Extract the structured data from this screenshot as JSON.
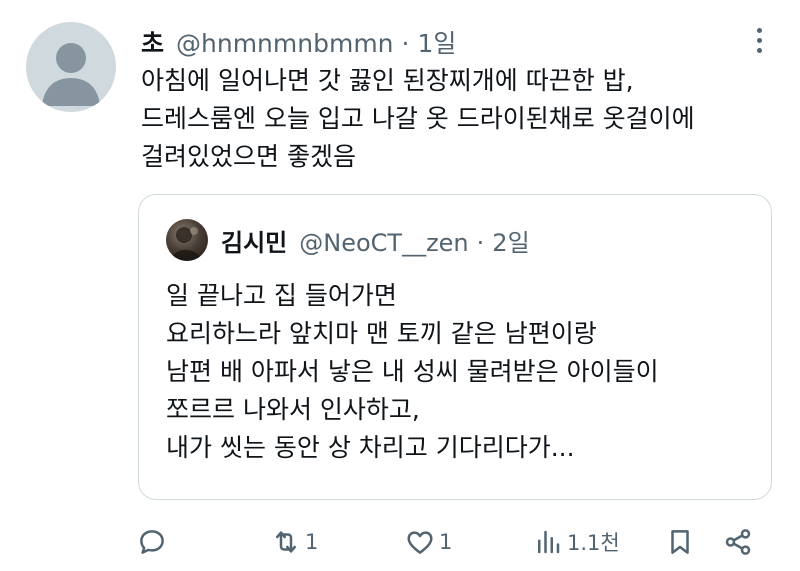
{
  "tweet": {
    "display_name": "초",
    "handle": "@hnmnmnbmmn",
    "separator": "·",
    "time": "1일",
    "lines": [
      "아침에 일어나면 갓 끓인 된장찌개에 따끈한 밥,",
      "드레스룸엔 오늘 입고 나갈 옷 드라이된채로 옷걸이에",
      "걸려있었으면 좋겠음"
    ]
  },
  "quote": {
    "display_name": "김시민",
    "handle": "@NeoCT__zen",
    "separator": "·",
    "time": "2일",
    "lines": [
      "일 끝나고 집 들어가면",
      "요리하느라 앞치마 맨 토끼 같은 남편이랑",
      "남편 배 아파서 낳은 내 성씨 물려받은 아이들이",
      "쪼르르 나와서 인사하고,",
      "내가 씻는 동안 상 차리고 기다리다가..."
    ]
  },
  "actions": {
    "reply": {
      "icon": "reply-icon"
    },
    "retweet": {
      "icon": "retweet-icon",
      "count": "1"
    },
    "like": {
      "icon": "heart-icon",
      "count": "1"
    },
    "views": {
      "icon": "views-icon",
      "count": "1.1천"
    },
    "bookmark": {
      "icon": "bookmark-icon"
    },
    "share": {
      "icon": "share-icon"
    }
  },
  "colors": {
    "text": "#0f1419",
    "secondary": "#536471",
    "border": "#cfd9de",
    "avatar_bg": "#cfd9de"
  }
}
